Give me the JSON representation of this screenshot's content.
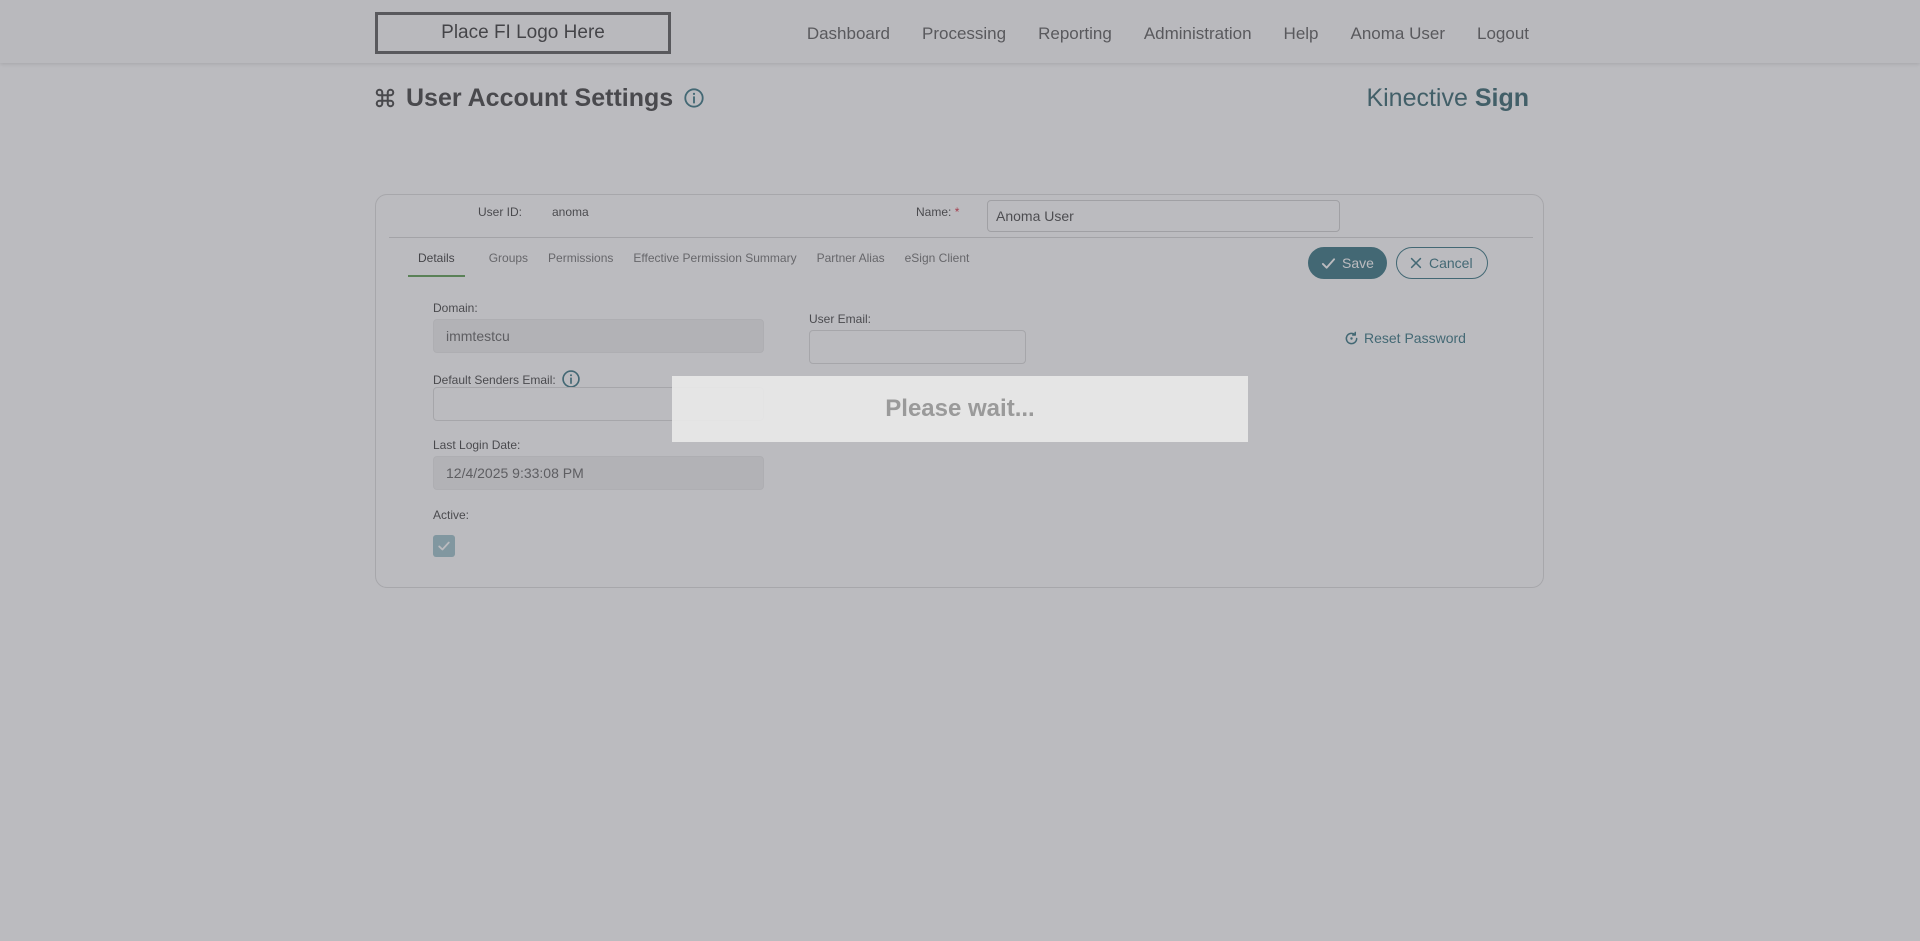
{
  "header": {
    "logo_text": "Place FI Logo Here",
    "nav": [
      "Dashboard",
      "Processing",
      "Reporting",
      "Administration",
      "Help",
      "Anoma User",
      "Logout"
    ]
  },
  "page": {
    "title": "User Account Settings",
    "brand_light": "Kinective ",
    "brand_bold": "Sign"
  },
  "form": {
    "user_id_label": "User ID:",
    "user_id_value": "anoma",
    "name_label": "Name:",
    "name_required": "*",
    "name_value": "Anoma User",
    "tabs": [
      "Details",
      "Groups",
      "Permissions",
      "Effective Permission Summary",
      "Partner Alias",
      "eSign Client"
    ],
    "active_tab": "Details",
    "save_label": "Save",
    "cancel_label": "Cancel",
    "domain_label": "Domain:",
    "domain_value": "immtestcu",
    "user_email_label": "User Email:",
    "user_email_value": "",
    "default_senders_email_label": "Default Senders Email:",
    "default_senders_email_value": "",
    "last_login_label": "Last Login Date:",
    "last_login_value": "12/4/2025 9:33:08 PM",
    "active_label": "Active:",
    "active_checked": true,
    "reset_password_label": "Reset Password"
  },
  "overlay": {
    "message": "Please wait..."
  },
  "colors": {
    "accent": "#0e5968",
    "tab_underline": "#3c8a2e",
    "required": "#d0021b",
    "brand": "#0d4650"
  },
  "icons": {
    "title_icon": "command-icon",
    "info_icon": "info-circle-icon",
    "save_icon": "check-icon",
    "cancel_icon": "close-icon",
    "reset_icon": "refresh-icon",
    "checkbox_icon": "check-icon"
  }
}
